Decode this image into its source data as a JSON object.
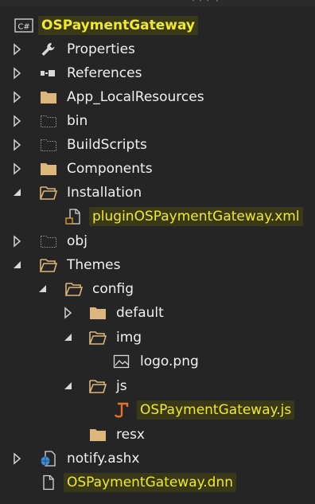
{
  "tree": {
    "top_fragment": "'' /  / /  ( ",
    "project": "OSPaymentGateway",
    "project_badge": "C#",
    "items": [
      {
        "label": "Properties",
        "icon": "wrench-icon",
        "arrow": "collapsed"
      },
      {
        "label": "References",
        "icon": "references-icon",
        "arrow": "collapsed"
      },
      {
        "label": "App_LocalResources",
        "icon": "folder-icon",
        "arrow": "collapsed"
      },
      {
        "label": "bin",
        "icon": "dotted-folder-icon",
        "arrow": "collapsed"
      },
      {
        "label": "BuildScripts",
        "icon": "dotted-folder-icon",
        "arrow": "collapsed"
      },
      {
        "label": "Components",
        "icon": "folder-icon",
        "arrow": "collapsed"
      },
      {
        "label": "Installation",
        "icon": "open-folder-icon",
        "arrow": "expanded"
      },
      {
        "label": "pluginOSPaymentGateway.xml",
        "icon": "xml-file-icon",
        "arrow": "none"
      },
      {
        "label": "obj",
        "icon": "dotted-folder-icon",
        "arrow": "collapsed"
      },
      {
        "label": "Themes",
        "icon": "open-folder-icon",
        "arrow": "expanded"
      },
      {
        "label": "config",
        "icon": "open-folder-icon",
        "arrow": "expanded"
      },
      {
        "label": "default",
        "icon": "folder-icon",
        "arrow": "collapsed"
      },
      {
        "label": "img",
        "icon": "open-folder-icon",
        "arrow": "expanded"
      },
      {
        "label": "logo.png",
        "icon": "image-file-icon",
        "arrow": "none"
      },
      {
        "label": "js",
        "icon": "open-folder-icon",
        "arrow": "expanded"
      },
      {
        "label": "OSPaymentGateway.js",
        "icon": "js-file-icon",
        "arrow": "none"
      },
      {
        "label": "resx",
        "icon": "folder-icon",
        "arrow": "none"
      },
      {
        "label": "notify.ashx",
        "icon": "ashx-file-icon",
        "arrow": "collapsed"
      },
      {
        "label": "OSPaymentGateway.dnn",
        "icon": "file-icon",
        "arrow": "none"
      }
    ]
  },
  "colors": {
    "background": "#252526",
    "text": "#f1f1f1",
    "highlight_bg": "#39391a",
    "highlight_text": "#f0e92a",
    "folder": "#dcb67a",
    "js_orange": "#e8712a",
    "ashx_blue": "#3c8fdb"
  }
}
